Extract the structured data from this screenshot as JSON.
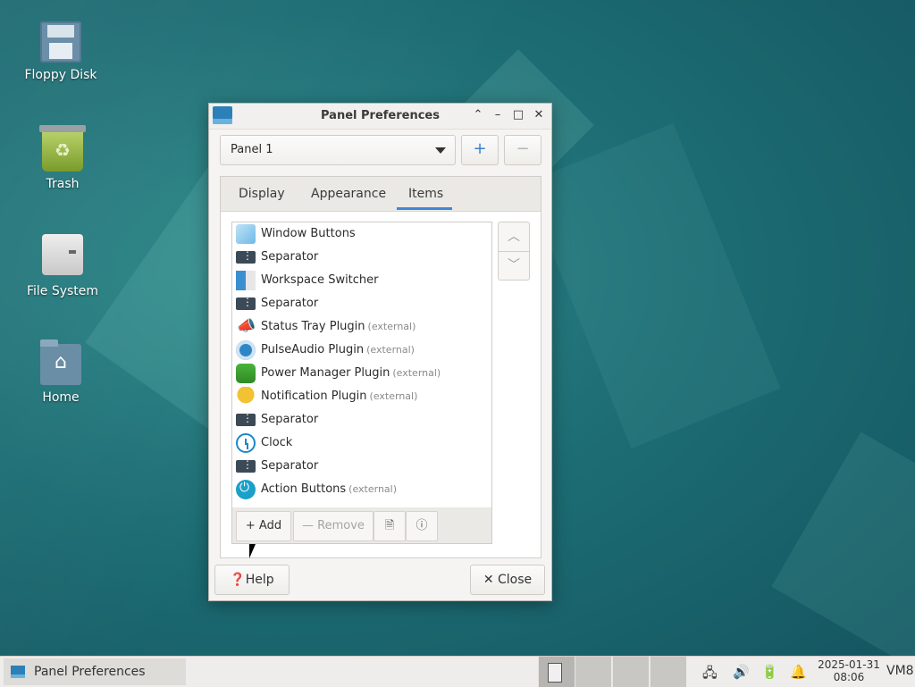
{
  "desktop": {
    "icons": [
      {
        "label": "Floppy Disk"
      },
      {
        "label": "Trash"
      },
      {
        "label": "File System"
      },
      {
        "label": "Home"
      }
    ]
  },
  "window": {
    "title": "Panel Preferences",
    "controls": {
      "shade": "⌃",
      "minimize": "–",
      "maximize": "□",
      "close": "✕"
    },
    "panel_select": {
      "value": "Panel 1"
    },
    "add_panel": "+",
    "remove_panel": "−",
    "tabs": [
      {
        "label": "Display"
      },
      {
        "label": "Appearance"
      },
      {
        "label": "Items",
        "active": true
      }
    ],
    "items": [
      {
        "name": "Window Buttons",
        "ext": "",
        "icon": "window-buttons-icon"
      },
      {
        "name": "Separator",
        "ext": "",
        "icon": "separator-icon"
      },
      {
        "name": "Workspace Switcher",
        "ext": "",
        "icon": "workspace-switcher-icon"
      },
      {
        "name": "Separator",
        "ext": "",
        "icon": "separator-icon"
      },
      {
        "name": "Status Tray Plugin",
        "ext": "(external)",
        "icon": "megaphone-icon"
      },
      {
        "name": "PulseAudio Plugin",
        "ext": "(external)",
        "icon": "audio-icon"
      },
      {
        "name": "Power Manager Plugin",
        "ext": "(external)",
        "icon": "battery-icon"
      },
      {
        "name": "Notification Plugin",
        "ext": "(external)",
        "icon": "bell-icon"
      },
      {
        "name": "Separator",
        "ext": "",
        "icon": "separator-icon"
      },
      {
        "name": "Clock",
        "ext": "",
        "icon": "clock-icon"
      },
      {
        "name": "Separator",
        "ext": "",
        "icon": "separator-icon"
      },
      {
        "name": "Action Buttons",
        "ext": "(external)",
        "icon": "power-icon"
      }
    ],
    "toolbar": {
      "add": "+ Add",
      "remove": "— Remove",
      "edit_icon": "🗎",
      "info_icon": "ⓘ"
    },
    "move_up": "︿",
    "move_down": "﹀",
    "help": "❓Help",
    "close": "✕ Close"
  },
  "taskbar": {
    "task_label": "Panel Preferences",
    "tray": {
      "network": "🖧",
      "volume": "🔊",
      "power": "🔋",
      "notifications": "🔔"
    },
    "date": "2025-01-31",
    "time": "08:06",
    "host": "VM8"
  }
}
